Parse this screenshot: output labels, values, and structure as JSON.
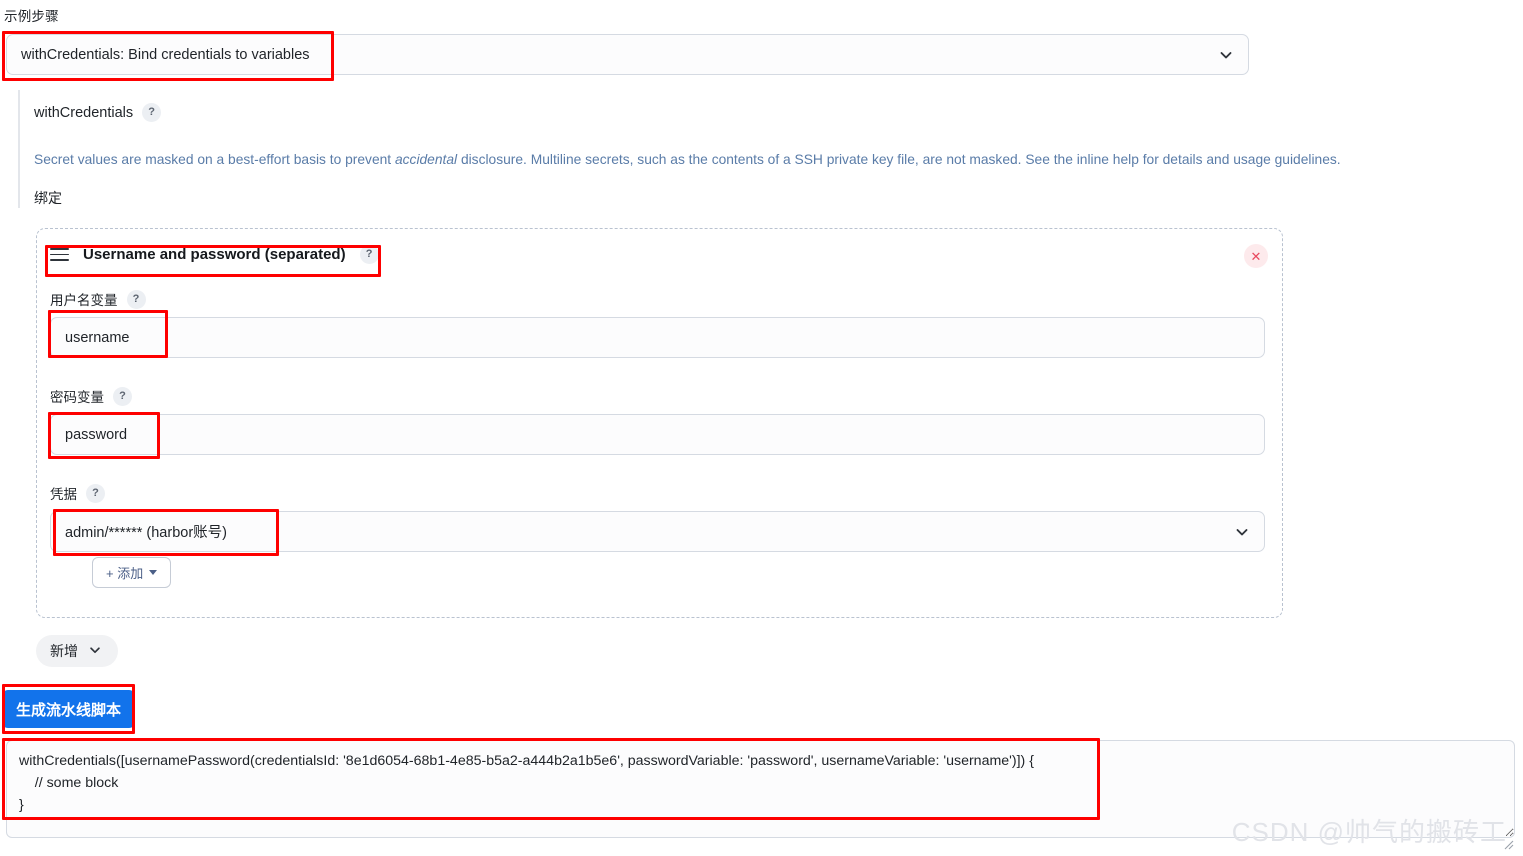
{
  "header": {
    "step_label": "示例步骤",
    "selected_step": "withCredentials: Bind credentials to variables",
    "chevron_icon": "chevron-down-icon"
  },
  "section": {
    "title": "withCredentials",
    "help_glyph": "?",
    "description_part1": "Secret values are masked on a best-effort basis to prevent ",
    "description_italic": "accidental",
    "description_part2": " disclosure. Multiline secrets, such as the contents of a SSH private key file, are not masked. See the inline help for details and usage guidelines.",
    "binding_label": "绑定"
  },
  "credential_block": {
    "drag_handle_icon": "hamburger-drag-icon",
    "title": "Username and password (separated)",
    "help_glyph": "?",
    "close_icon": "close-icon",
    "close_glyph": "✕",
    "fields": [
      {
        "label": "用户名变量",
        "help_glyph": "?",
        "value": "username",
        "type": "text"
      },
      {
        "label": "密码变量",
        "help_glyph": "?",
        "value": "password",
        "type": "text"
      },
      {
        "label": "凭据",
        "help_glyph": "?",
        "value": "admin/****** (harbor账号)",
        "type": "select"
      }
    ],
    "add_button": "+ 添加"
  },
  "actions": {
    "new_button": "新增",
    "new_chevron_icon": "chevron-down-icon",
    "generate_button": "生成流水线脚本"
  },
  "output": {
    "code": "withCredentials([usernamePassword(credentialsId: '8e1d6054-68b1-4e85-b5a2-a444b2a1b5e6', passwordVariable: 'password', usernameVariable: 'username')]) {\n    // some block\n}"
  },
  "watermark": {
    "text": "CSDN @帅气的搬砖工"
  },
  "colors": {
    "annotation": "#fe0000",
    "primary_button": "#1273eb",
    "description_text": "#5a7ca8",
    "close_icon": "#e8485e"
  }
}
